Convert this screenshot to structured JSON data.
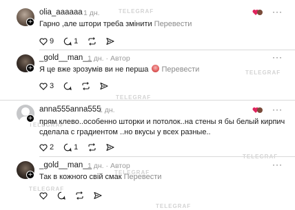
{
  "watermark": "TELEGRAF",
  "comments": [
    {
      "username": "olia_aaaaaa",
      "time": "1 дн.",
      "text": "Гарно ,але штори треба змінити",
      "translate": "Перевести",
      "likes": "9",
      "replies": "1",
      "has_reactions": true
    },
    {
      "username": "_gold__man__",
      "time": "1 дн.",
      "author_label": "Автор",
      "text": "Я це вже зрозумів ви не перша",
      "translate": "Перевести",
      "likes": "3",
      "replies": ""
    },
    {
      "username": "anna555anna555",
      "time": "1 дн.",
      "text_lines": [
        "прям клево..особенно шторки и потолок..на стены я бы белый кирпич",
        "сделала с градиентом ..но вкусы у всех разные.."
      ],
      "likes": "2",
      "replies": "1",
      "has_reactions": true
    },
    {
      "username": "_gold__man__",
      "time": "1 дн.",
      "author_label": "Автор",
      "text": "Так в кожного свій смак",
      "translate": "Перевести",
      "likes": "",
      "replies": ""
    }
  ]
}
